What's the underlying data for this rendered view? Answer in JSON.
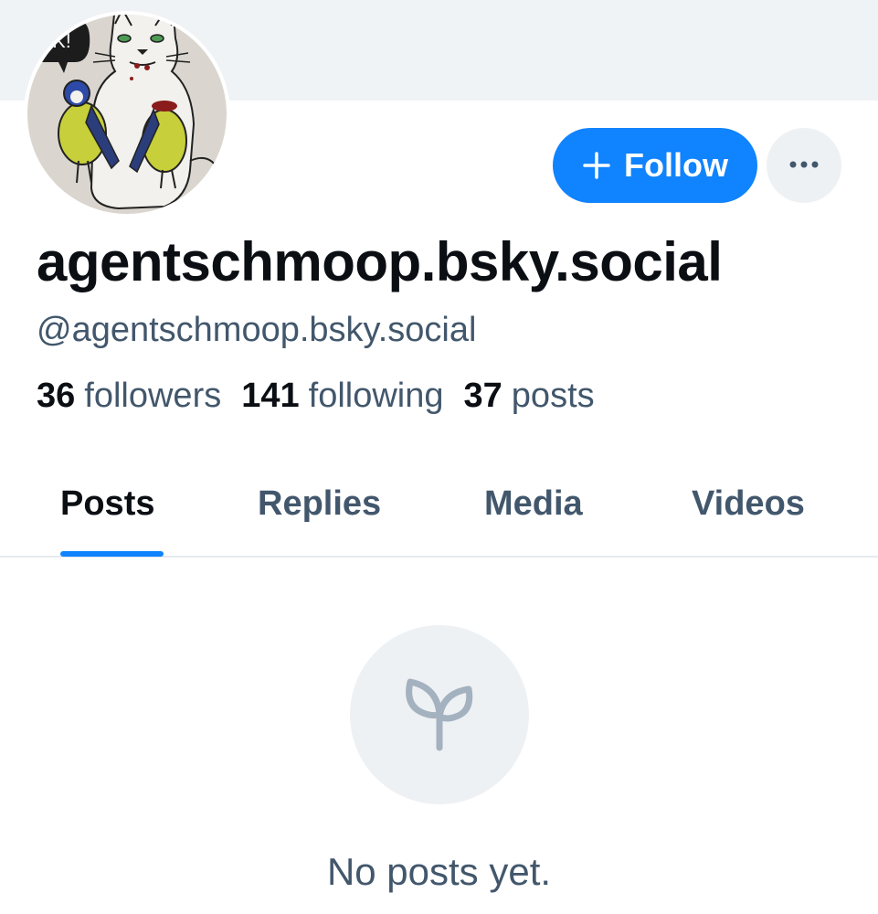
{
  "profile": {
    "display_name": "agentschmoop.bsky.social",
    "handle": "@agentschmoop.bsky.social",
    "avatar_speech_text": "OK!"
  },
  "actions": {
    "follow_label": "Follow",
    "more_icon": "ellipsis-icon"
  },
  "stats": [
    {
      "value": "36",
      "label": "followers"
    },
    {
      "value": "141",
      "label": "following"
    },
    {
      "value": "37",
      "label": "posts"
    }
  ],
  "tabs": [
    {
      "label": "Posts",
      "active": true
    },
    {
      "label": "Replies",
      "active": false
    },
    {
      "label": "Media",
      "active": false
    },
    {
      "label": "Videos",
      "active": false
    }
  ],
  "empty_state": {
    "icon": "sprout-icon",
    "message": "No posts yet."
  },
  "colors": {
    "accent": "#1083fe",
    "text_primary": "#0b0f14",
    "text_secondary": "#42576c",
    "banner": "#f0f3f5"
  }
}
